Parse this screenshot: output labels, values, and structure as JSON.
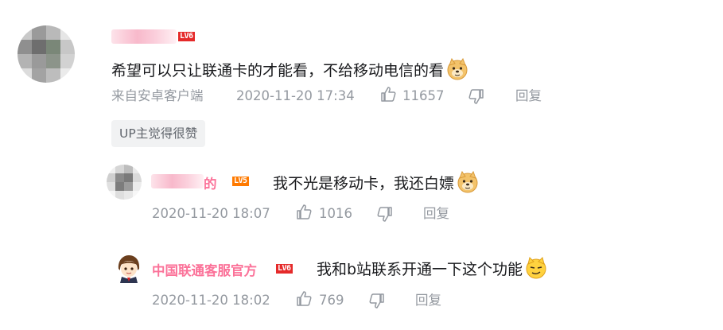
{
  "comment": {
    "level": "LV6",
    "text": "希望可以只让联通卡的才能看，不给移动电信的看",
    "emoji": "doge",
    "source": "来自安卓客户端",
    "time": "2020-11-20 17:34",
    "likes": "11657",
    "reply_label": "回复",
    "tag": "UP主觉得很赞"
  },
  "replies": [
    {
      "name_partial": "的",
      "level": "LV5",
      "text": "我不光是移动卡，我还白嫖",
      "emoji": "doge",
      "time": "2020-11-20 18:07",
      "likes": "1016",
      "reply_label": "回复"
    },
    {
      "name": "中国联通客服官方",
      "level": "LV6",
      "text": "我和b站联系开通一下这个功能",
      "emoji": "smirk",
      "time": "2020-11-20 18:02",
      "likes": "769",
      "reply_label": "回复"
    }
  ],
  "colors": {
    "vip_pink": "#fb7299",
    "meta_gray": "#9499a0",
    "lv6_red": "#e52a2a",
    "lv5_orange": "#ff7a00"
  }
}
